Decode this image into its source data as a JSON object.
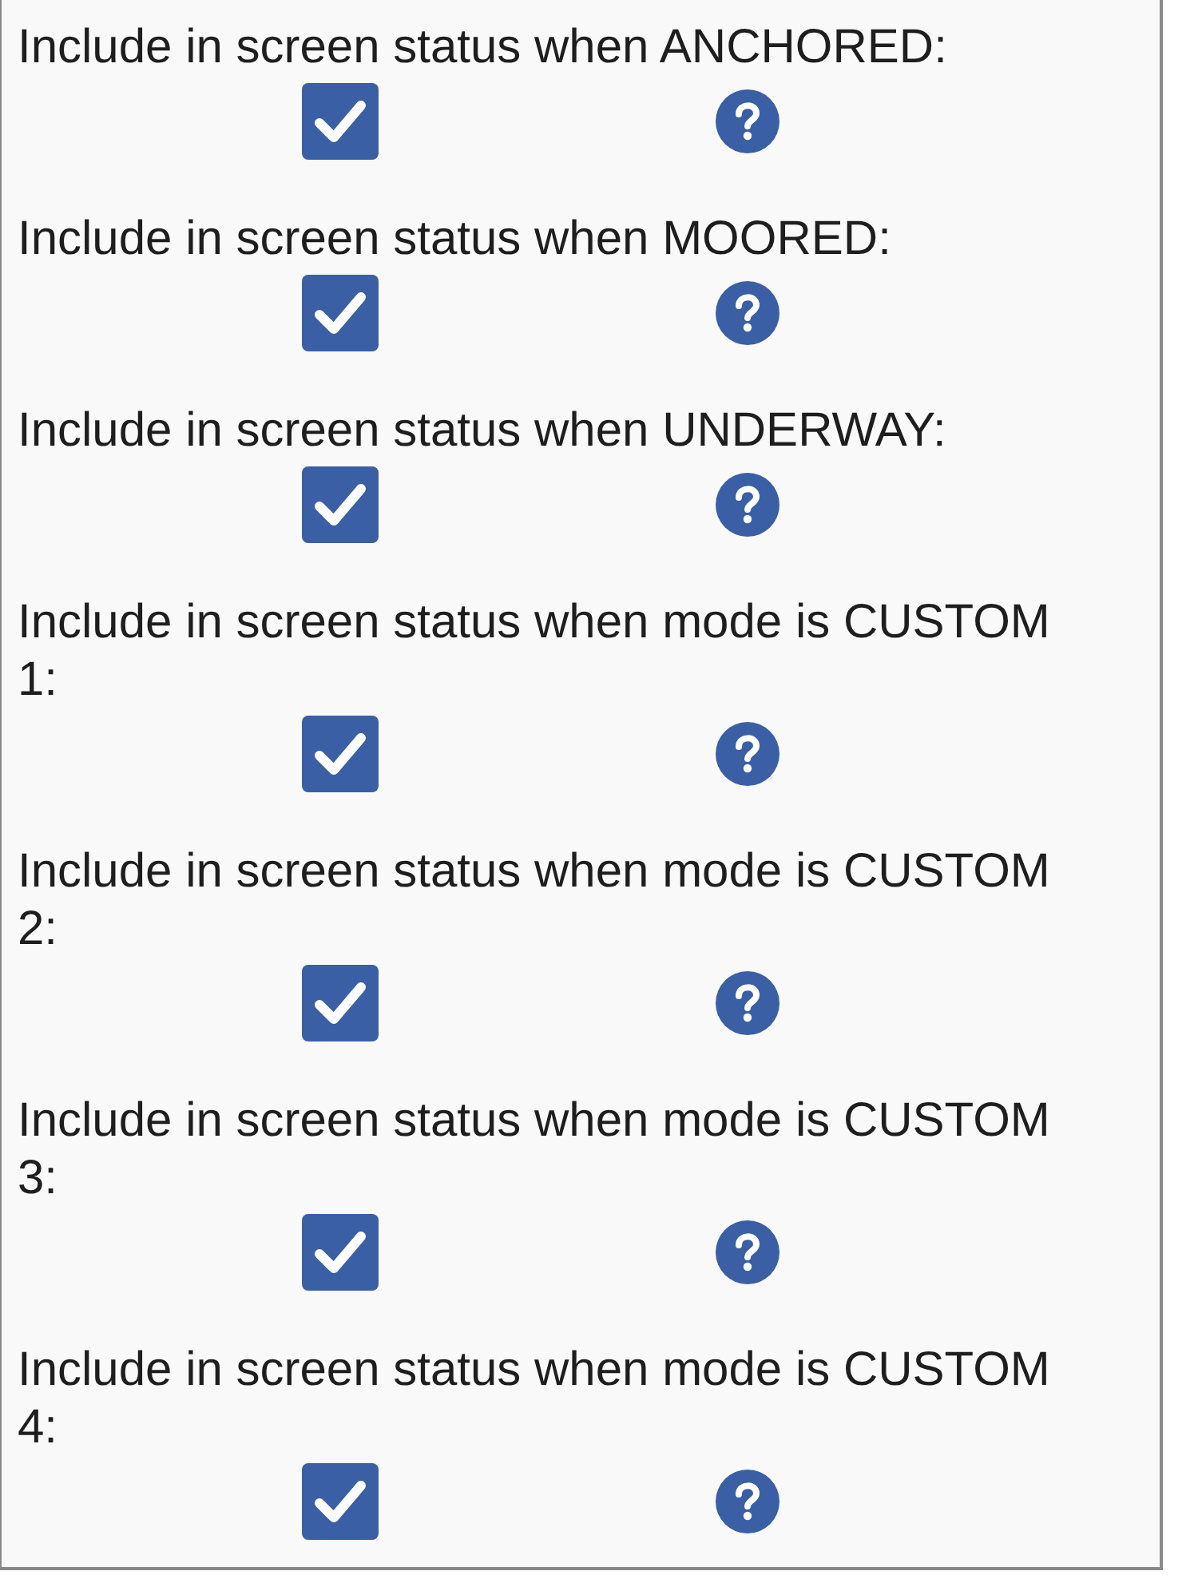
{
  "settings": [
    {
      "label": "Include in screen status when ANCHORED:",
      "checked": true
    },
    {
      "label": "Include in screen status when MOORED:",
      "checked": true
    },
    {
      "label": "Include in screen status when UNDERWAY:",
      "checked": true
    },
    {
      "label": "Include in screen status when mode is CUSTOM 1:",
      "checked": true
    },
    {
      "label": "Include in screen status when mode is CUSTOM 2:",
      "checked": true
    },
    {
      "label": "Include in screen status when mode is CUSTOM 3:",
      "checked": true
    },
    {
      "label": "Include in screen status when mode is CUSTOM 4:",
      "checked": true
    }
  ]
}
